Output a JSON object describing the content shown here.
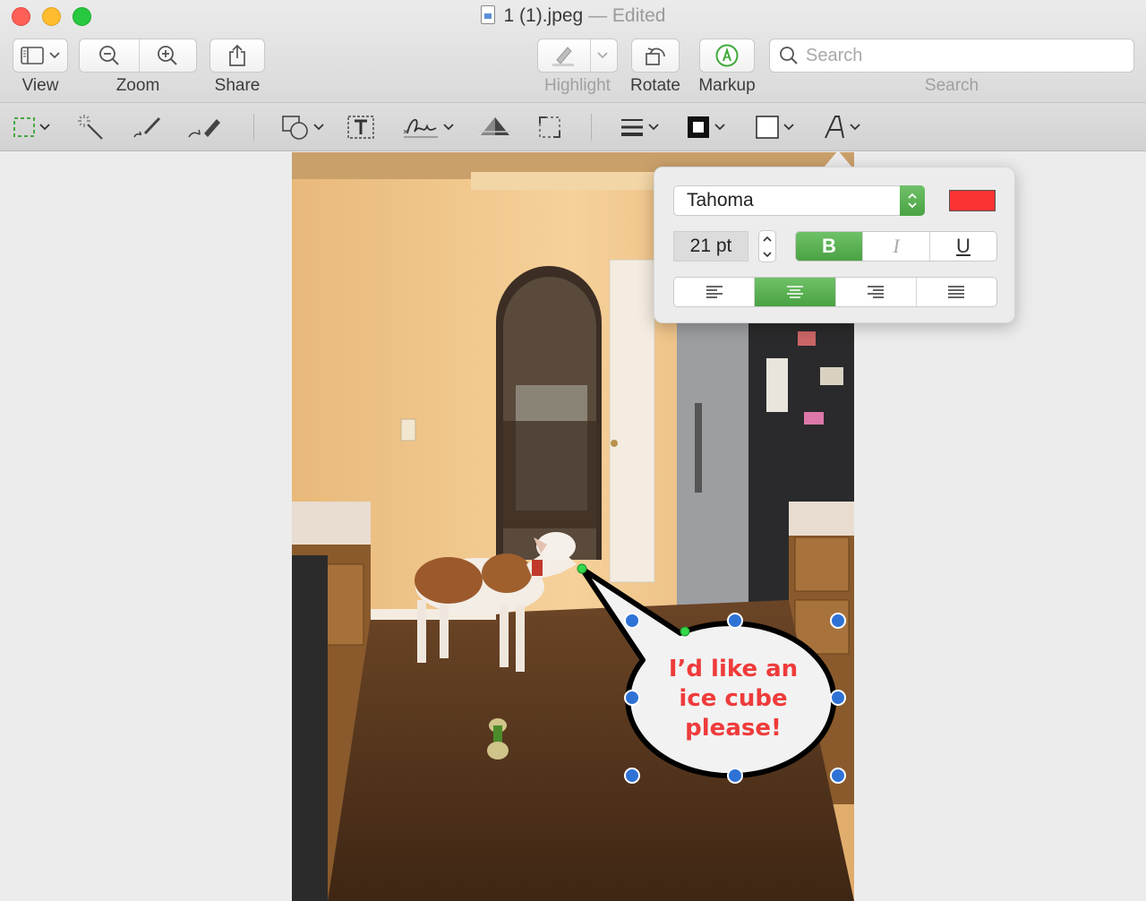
{
  "window": {
    "title": "1 (1).jpeg",
    "title_status": "— Edited"
  },
  "toolbar": {
    "view_label": "View",
    "zoom_label": "Zoom",
    "share_label": "Share",
    "highlight_label": "Highlight",
    "rotate_label": "Rotate",
    "markup_label": "Markup",
    "search_label": "Search",
    "search_placeholder": "Search"
  },
  "markup_tools": [
    {
      "name": "rectangular-selection",
      "icon": "dashed-rect-icon"
    },
    {
      "name": "instant-alpha",
      "icon": "magic-wand-icon"
    },
    {
      "name": "sketch",
      "icon": "sketch-pen-icon"
    },
    {
      "name": "draw",
      "icon": "draw-pen-icon"
    },
    {
      "name": "shapes",
      "icon": "shapes-icon"
    },
    {
      "name": "text",
      "icon": "text-box-icon"
    },
    {
      "name": "sign",
      "icon": "signature-icon"
    },
    {
      "name": "adjust-color",
      "icon": "adjust-color-icon"
    },
    {
      "name": "adjust-size",
      "icon": "resize-icon"
    },
    {
      "name": "shape-style",
      "icon": "lines-icon"
    },
    {
      "name": "border-color",
      "icon": "border-color-icon"
    },
    {
      "name": "fill-color",
      "icon": "fill-color-icon"
    },
    {
      "name": "text-style",
      "icon": "text-style-icon"
    }
  ],
  "font_popover": {
    "font_name": "Tahoma",
    "font_color": "#fb3333",
    "font_size": "21 pt",
    "style_buttons": [
      {
        "label": "B",
        "active": true
      },
      {
        "label": "I",
        "active": false
      },
      {
        "label": "U",
        "active": false
      }
    ],
    "alignments": [
      {
        "name": "left",
        "active": false
      },
      {
        "name": "center",
        "active": true
      },
      {
        "name": "right",
        "active": false
      },
      {
        "name": "justify",
        "active": false
      }
    ]
  },
  "speech_bubble": {
    "lines": [
      "I’d like an",
      "ice cube",
      "please!"
    ],
    "text_color": "#ef3b3b"
  }
}
